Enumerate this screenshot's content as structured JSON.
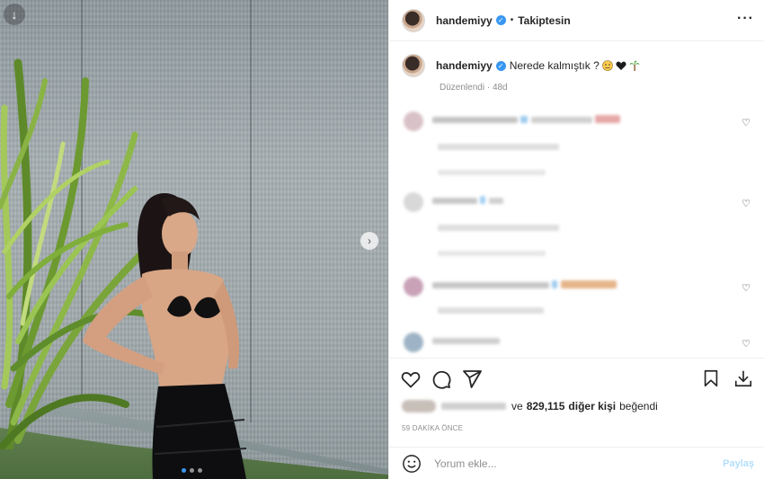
{
  "post": {
    "username": "handemiyy",
    "verified": true,
    "follow_status": "Takiptesin",
    "more_icon": "more-options-icon"
  },
  "caption": {
    "username": "handemiyy",
    "text": "Nerede kalmıştık ?",
    "emojis": [
      "face-emoji",
      "black-heart-emoji",
      "palm-tree-emoji"
    ],
    "edited_label": "Düzenlendi",
    "age": "48d"
  },
  "likes": {
    "suffix_prefix": "ve",
    "count": "829,115",
    "suffix": "diğer kişi",
    "verb": "beğendi"
  },
  "timestamp": "59 DAKİKA ÖNCE",
  "comment_input": {
    "placeholder": "Yorum ekle...",
    "share_label": "Paylaş"
  },
  "carousel": {
    "total_slides": 3,
    "active_slide": 1
  },
  "colors": {
    "accent": "#3897f0",
    "share_disabled": "#b2dffc"
  }
}
